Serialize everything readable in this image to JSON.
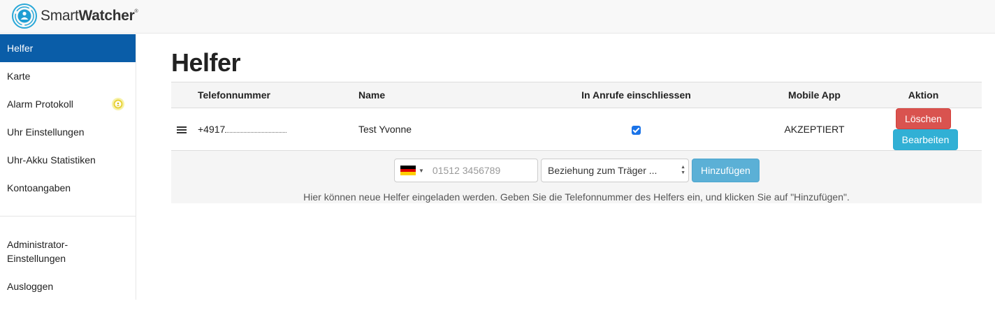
{
  "brand": {
    "name_light": "Smart",
    "name_bold": "Watcher",
    "trademark": "®"
  },
  "sidebar": {
    "items": [
      {
        "label": "Helfer",
        "active": true
      },
      {
        "label": "Karte"
      },
      {
        "label": "Alarm Protokoll",
        "icon": "alarm-status-icon"
      },
      {
        "label": "Uhr Einstellungen"
      },
      {
        "label": "Uhr-Akku Statistiken"
      },
      {
        "label": "Kontoangaben"
      }
    ],
    "bottom_items": [
      {
        "label": "Administrator-Einstellungen"
      },
      {
        "label": "Ausloggen"
      }
    ]
  },
  "page": {
    "title": "Helfer"
  },
  "table": {
    "headers": [
      "Telefonnummer",
      "Name",
      "In Anrufe einschliessen",
      "Mobile App",
      "Aktion"
    ],
    "rows": [
      {
        "phone": "+4917",
        "name": "Test Yvonne",
        "include_calls": true,
        "mobile_app": "AKZEPTIERT",
        "delete_label": "Löschen",
        "edit_label": "Bearbeiten"
      }
    ]
  },
  "add_helper": {
    "country_flag": "de-flag-icon",
    "phone_placeholder": "01512 3456789",
    "relation_select": "Beziehung zum Träger ...",
    "add_label": "Hinzufügen",
    "hint": "Hier können neue Helfer eingeladen werden. Geben Sie die Telefonnummer des Helfers ein, und klicken Sie auf \"Hinzufügen\"."
  },
  "colors": {
    "nav_active": "#0a5da8",
    "danger": "#d9534f",
    "info": "#31b0d5",
    "primary_lite": "#5bb0d6"
  }
}
